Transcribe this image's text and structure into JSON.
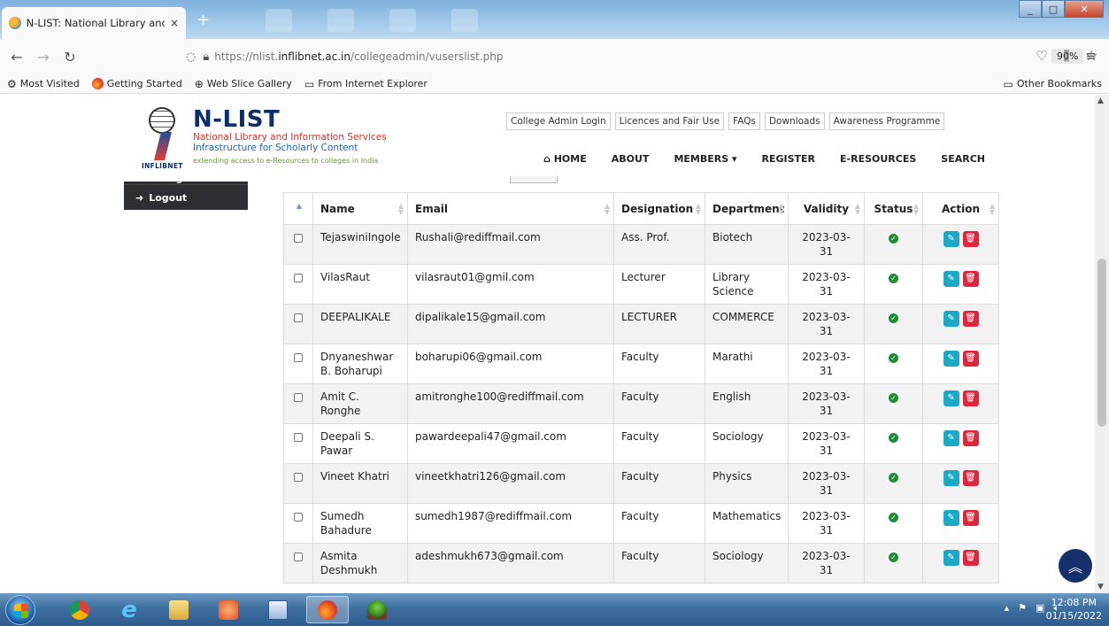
{
  "browser": {
    "tab_title": "N-LIST: National Library and Inf",
    "tab_close": "×",
    "new_tab": "+",
    "url_prefix": "https://nlist.",
    "url_domain": "inflibnet.ac.in",
    "url_path": "/collegeadmin/vuserslist.php",
    "zoom": "90%",
    "bookmarks": [
      "Most Visited",
      "Getting Started",
      "Web Slice Gallery",
      "From Internet Explorer"
    ],
    "other_bookmarks": "Other Bookmarks"
  },
  "site": {
    "logo_title": "N-LIST",
    "logo_line1": "National Library and Information Services",
    "logo_line2": "Infrastructure for Scholarly Content",
    "logo_line3": "extending access to e-Resources to colleges in India",
    "logo_small": "INFLIBNET",
    "top_links": [
      "College Admin Login",
      "Licences and Fair Use",
      "FAQs",
      "Downloads",
      "Awareness Programme"
    ],
    "nav": [
      "HOME",
      "ABOUT",
      "MEMBERS",
      "REGISTER",
      "E-RESOURCES",
      "SEARCH"
    ]
  },
  "sidebar": {
    "change_password": "Change Password",
    "logout": "Logout"
  },
  "table": {
    "headers": [
      "",
      "Name",
      "Email",
      "Designation",
      "Department",
      "Validity",
      "Status",
      "Action"
    ],
    "rows": [
      {
        "name": "TejaswiniIngole",
        "email": "Rushali@rediffmail.com",
        "designation": "Ass. Prof.",
        "department": "Biotech",
        "validity": "2023-03-31"
      },
      {
        "name": "VilasRaut",
        "email": "vilasraut01@gmil.com",
        "designation": "Lecturer",
        "department": "Library Science",
        "validity": "2023-03-31"
      },
      {
        "name": "DEEPALIKALE",
        "email": "dipalikale15@gmail.com",
        "designation": "LECTURER",
        "department": "COMMERCE",
        "validity": "2023-03-31"
      },
      {
        "name": "Dnyaneshwar B. Boharupi",
        "email": "boharupi06@gmail.com",
        "designation": "Faculty",
        "department": "Marathi",
        "validity": "2023-03-31"
      },
      {
        "name": "Amit C. Ronghe",
        "email": "amitronghe100@rediffmail.com",
        "designation": "Faculty",
        "department": "English",
        "validity": "2023-03-31"
      },
      {
        "name": "Deepali S. Pawar",
        "email": "pawardeepali47@gmail.com",
        "designation": "Faculty",
        "department": "Sociology",
        "validity": "2023-03-31"
      },
      {
        "name": "Vineet Khatri",
        "email": "vineetkhatri126@gmail.com",
        "designation": "Faculty",
        "department": "Physics",
        "validity": "2023-03-31"
      },
      {
        "name": "Sumedh Bahadure",
        "email": "sumedh1987@rediffmail.com",
        "designation": "Faculty",
        "department": "Mathematics",
        "validity": "2023-03-31"
      },
      {
        "name": "Asmita Deshmukh",
        "email": "adeshmukh673@gmail.com",
        "designation": "Faculty",
        "department": "Sociology",
        "validity": "2023-03-31"
      }
    ]
  },
  "taskbar": {
    "time": "12:08 PM",
    "date": "01/15/2022"
  },
  "colors": {
    "brand_navy": "#0c2f6b",
    "edit": "#1ba9c6",
    "delete": "#e0243c",
    "status_ok": "#1f8c3a"
  }
}
